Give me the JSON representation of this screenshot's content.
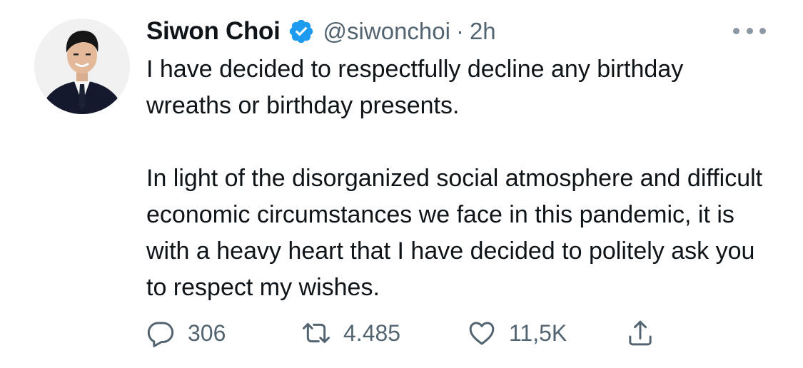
{
  "tweet": {
    "author": {
      "display_name": "Siwon Choi",
      "verified": true,
      "handle": "@siwonchoi",
      "separator": "·",
      "time": "2h"
    },
    "body": [
      "I have decided to respectfully decline any birthday wreaths or birthday presents.",
      "In light of the disorganized social atmosphere and difficult economic circumstances we face in this pandemic, it is with a heavy heart that I have decided to politely ask you to respect my wishes."
    ],
    "actions": {
      "replies": "306",
      "retweets": "4.485",
      "likes": "11,5K"
    }
  },
  "icons": {
    "more": "more-horizontal-icon",
    "verified": "verified-badge-icon",
    "reply": "reply-icon",
    "retweet": "retweet-icon",
    "like": "heart-icon",
    "share": "share-icon"
  },
  "colors": {
    "text": "#0f1419",
    "secondary": "#536471",
    "verified_blue": "#1d9bf0",
    "background": "#ffffff"
  }
}
